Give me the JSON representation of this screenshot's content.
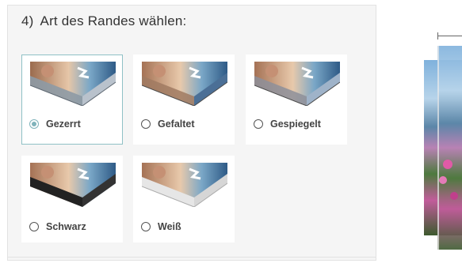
{
  "section": {
    "number": "4)",
    "title": "Art des Randes wählen:"
  },
  "options": [
    {
      "label": "Gezerrt",
      "selected": true,
      "edge": "stretched"
    },
    {
      "label": "Gefaltet",
      "selected": false,
      "edge": "folded"
    },
    {
      "label": "Gespiegelt",
      "selected": false,
      "edge": "mirrored"
    },
    {
      "label": "Schwarz",
      "selected": false,
      "edge": "black"
    },
    {
      "label": "Weiß",
      "selected": false,
      "edge": "white"
    }
  ],
  "colors": {
    "accent": "#7fb3bb",
    "panel_bg": "#f5f5f5",
    "text": "#333333"
  }
}
